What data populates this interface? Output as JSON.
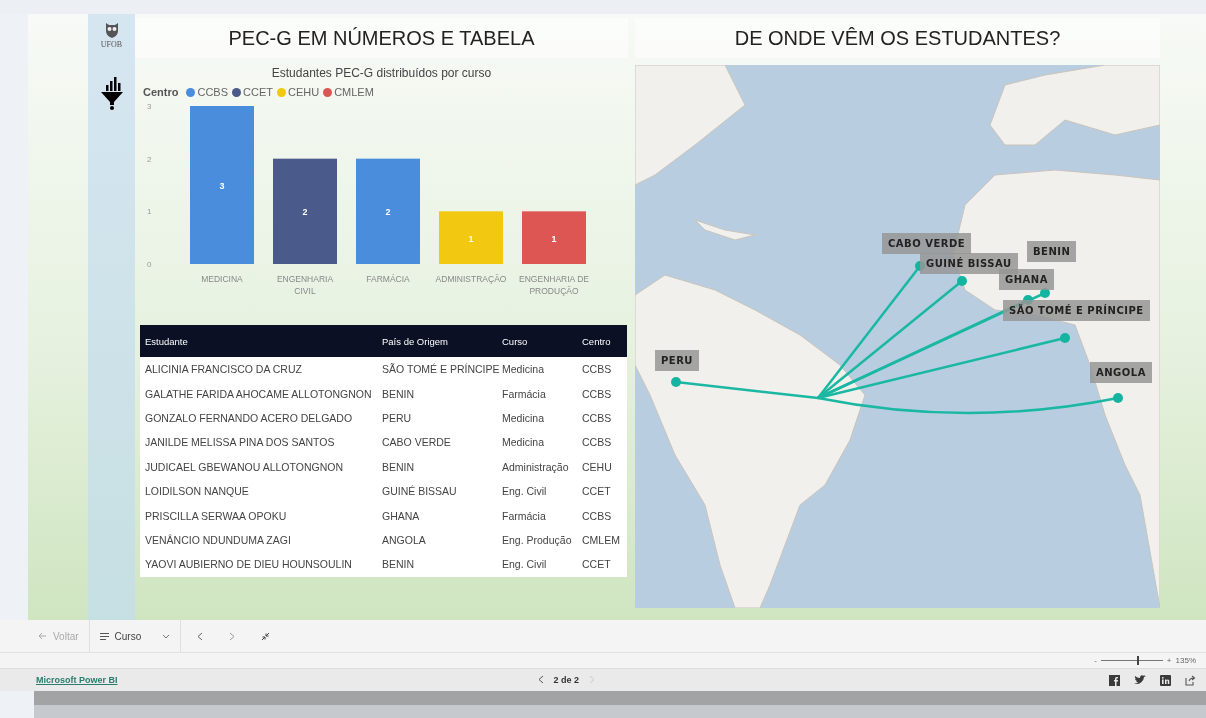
{
  "sidebar": {
    "logo_text": "UFOB"
  },
  "left_panel": {
    "title": "PEC-G EM NÚMEROS E TABELA",
    "chart": {
      "legend_title": "Centro",
      "chart_data": {
        "type": "bar",
        "title": "Estudantes PEC-G distribuídos por curso",
        "categories": [
          "MEDICINA",
          "ENGENHARIA CIVIL",
          "FARMÁCIA",
          "ADMINISTRAÇÃO",
          "ENGENHARIA DE PRODUÇÃO"
        ],
        "series": [
          {
            "name": "CCBS",
            "color": "#4a8ddc",
            "values": [
              3,
              null,
              2,
              null,
              null
            ]
          },
          {
            "name": "CCET",
            "color": "#4a5a8a",
            "values": [
              null,
              2,
              null,
              null,
              null
            ]
          },
          {
            "name": "CEHU",
            "color": "#f2c811",
            "values": [
              null,
              null,
              null,
              1,
              null
            ]
          },
          {
            "name": "CMLEM",
            "color": "#de5654",
            "values": [
              null,
              null,
              null,
              null,
              1
            ]
          }
        ],
        "stacked": true,
        "ylim": [
          0,
          3
        ],
        "yticks": [
          0,
          1,
          2,
          3
        ],
        "data_labels": true
      }
    },
    "table": {
      "columns": [
        "Estudante",
        "País de Origem",
        "Curso",
        "Centro"
      ],
      "rows": [
        [
          "ALICINIA FRANCISCO DA CRUZ",
          "SÃO TOMÉ E PRÍNCIPE",
          "Medicina",
          "CCBS"
        ],
        [
          "GALATHE FARIDA AHOCAME ALLOTONGNON",
          "BENIN",
          "Farmácia",
          "CCBS"
        ],
        [
          "GONZALO FERNANDO ACERO DELGADO",
          "PERU",
          "Medicina",
          "CCBS"
        ],
        [
          "JANILDE MELISSA PINA DOS SANTOS",
          "CABO VERDE",
          "Medicina",
          "CCBS"
        ],
        [
          "JUDICAEL GBEWANOU ALLOTONGNON",
          "BENIN",
          "Administração",
          "CEHU"
        ],
        [
          "LOIDILSON NANQUE",
          "GUINÉ BISSAU",
          "Eng. Civil",
          "CCET"
        ],
        [
          "PRISCILLA SERWAA OPOKU",
          "GHANA",
          "Farmácia",
          "CCBS"
        ],
        [
          "VENÂNCIO NDUNDUMA ZAGI",
          "ANGOLA",
          "Eng. Produção",
          "CMLEM"
        ],
        [
          "YAOVI AUBIERNO DE DIEU HOUNSOULIN",
          "BENIN",
          "Eng. Civil",
          "CCET"
        ]
      ]
    }
  },
  "right_panel": {
    "title": "DE ONDE VÊM OS ESTUDANTES?",
    "map": {
      "origins": [
        {
          "label": "CABO VERDE"
        },
        {
          "label": "GUINÉ BISSAU"
        },
        {
          "label": "BENIN"
        },
        {
          "label": "GHANA"
        },
        {
          "label": "SÃO TOMÉ E PRÍNCIPE"
        },
        {
          "label": "PERU"
        },
        {
          "label": "ANGOLA"
        }
      ]
    }
  },
  "toolbar": {
    "back": {
      "label": "Voltar",
      "disabled": true
    },
    "bookmarks": {
      "label": "Curso"
    }
  },
  "zoom": {
    "minus": "-",
    "plus": "+",
    "level": 0.58,
    "reading": "135%"
  },
  "footer": {
    "brand": "Microsoft Power BI",
    "page": "2 de 2",
    "prev_disabled": false,
    "next_disabled": true
  }
}
